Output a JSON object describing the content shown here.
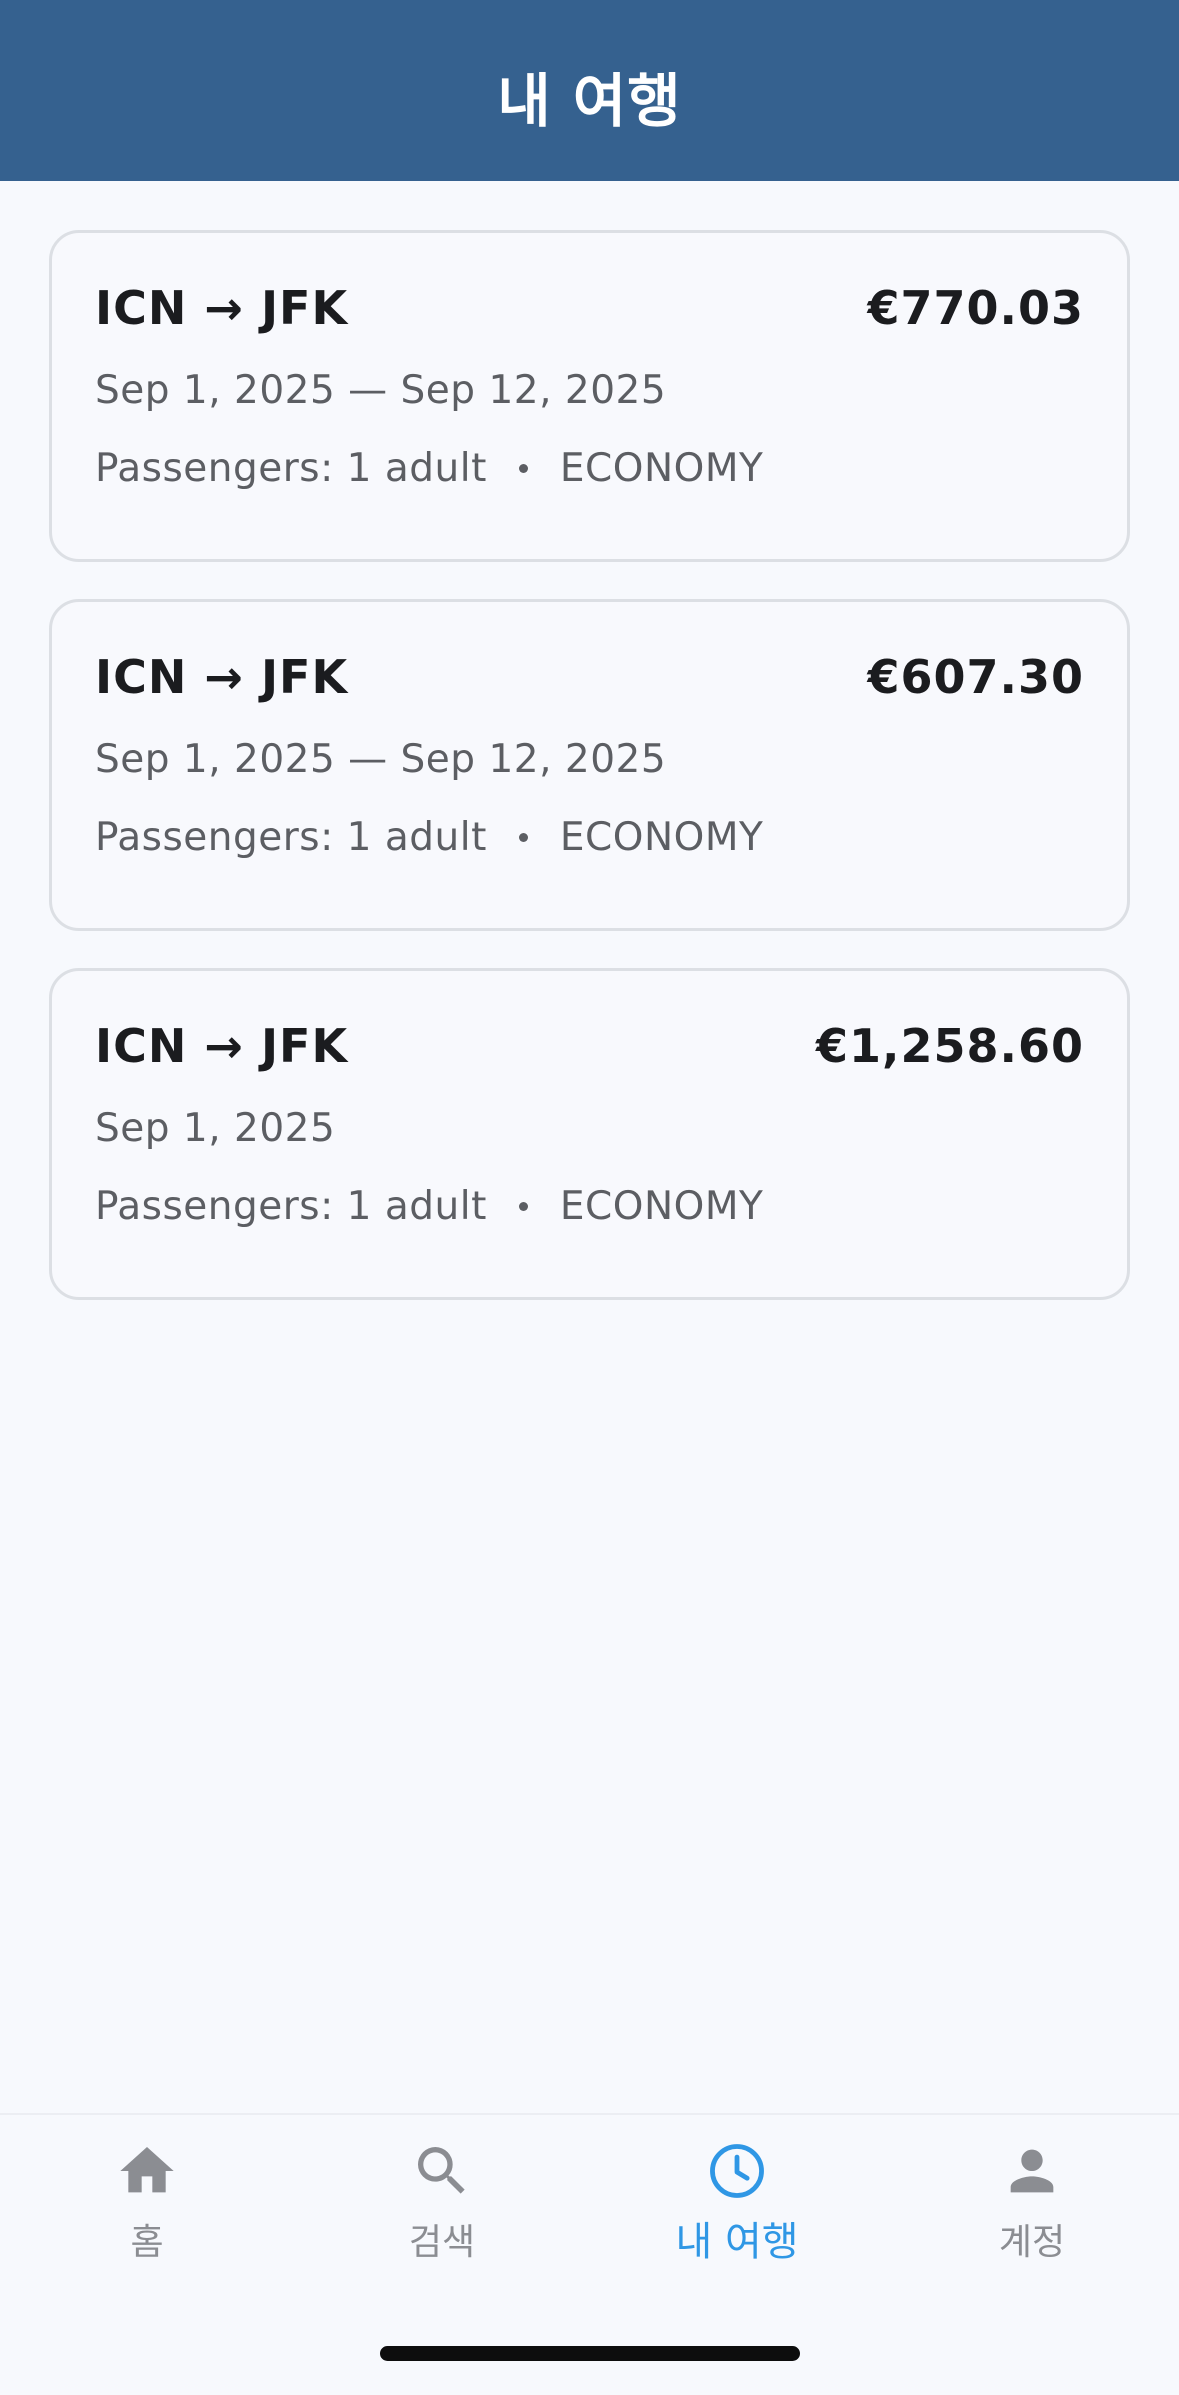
{
  "app_bar": {
    "title": "내 여행"
  },
  "trips": [
    {
      "route": "ICN → JFK",
      "price": "€770.03",
      "dates": "Sep 1, 2025 — Sep 12, 2025",
      "passengers": "Passengers: 1 adult",
      "cabin": "ECONOMY"
    },
    {
      "route": "ICN → JFK",
      "price": "€607.30",
      "dates": "Sep 1, 2025 — Sep 12, 2025",
      "passengers": "Passengers: 1 adult",
      "cabin": "ECONOMY"
    },
    {
      "route": "ICN → JFK",
      "price": "€1,258.60",
      "dates": "Sep 1, 2025",
      "passengers": "Passengers: 1 adult",
      "cabin": "ECONOMY"
    }
  ],
  "bottom_nav": {
    "items": [
      {
        "label": "홈",
        "icon": "home-icon",
        "active": false
      },
      {
        "label": "검색",
        "icon": "search-icon",
        "active": false
      },
      {
        "label": "내 여행",
        "icon": "clock-icon",
        "active": true
      },
      {
        "label": "계정",
        "icon": "person-icon",
        "active": false
      }
    ]
  },
  "colors": {
    "app_bar": "#35618f",
    "active_tab": "#2f97e5",
    "inactive_tab": "#8b8d92",
    "background": "#f7f9fd"
  }
}
